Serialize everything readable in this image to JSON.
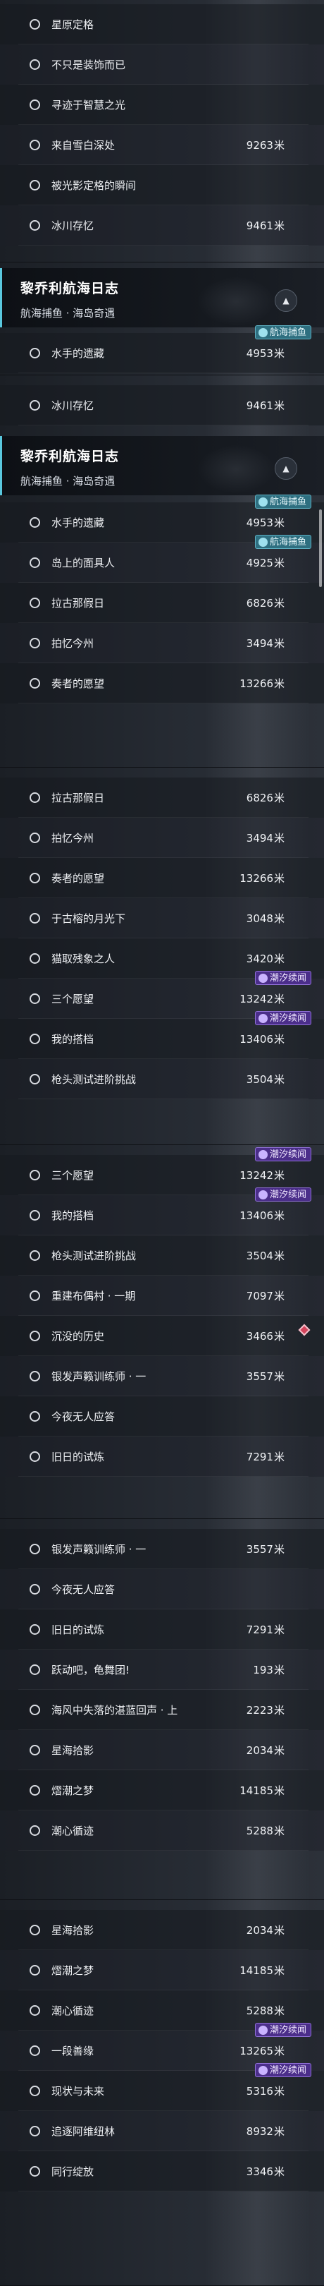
{
  "unit": "米",
  "badges": {
    "voyage": "航海捕鱼",
    "spring": "潮汐续闻"
  },
  "header": {
    "title": "黎乔利航海日志",
    "subtitle": "航海捕鱼 · 海岛奇遇",
    "toggle_icon": "chevron-up-icon"
  },
  "segments": [
    {
      "rows": [
        {
          "name": "星原定格",
          "dist": ""
        },
        {
          "name": "不只是装饰而已",
          "dist": ""
        },
        {
          "name": "寻迹于智慧之光",
          "dist": ""
        },
        {
          "name": "来自雪白深处",
          "dist": "9263"
        },
        {
          "name": "被光影定格的瞬间",
          "dist": ""
        },
        {
          "name": "冰川存忆",
          "dist": "9461"
        }
      ]
    },
    {
      "rows": [
        {
          "name": "水手的遗藏",
          "dist": "4953",
          "badge": "voyage"
        }
      ]
    },
    {
      "rows": [
        {
          "name": "冰川存忆",
          "dist": "9461"
        }
      ]
    },
    {
      "rows": [
        {
          "name": "水手的遗藏",
          "dist": "4953",
          "badge": "voyage"
        },
        {
          "name": "岛上的面具人",
          "dist": "4925",
          "badge": "voyage"
        },
        {
          "name": "拉古那假日",
          "dist": "6826"
        },
        {
          "name": "拍忆今州",
          "dist": "3494"
        },
        {
          "name": "奏者的愿望",
          "dist": "13266"
        }
      ]
    },
    {
      "rows": [
        {
          "name": "拉古那假日",
          "dist": "6826"
        },
        {
          "name": "拍忆今州",
          "dist": "3494"
        },
        {
          "name": "奏者的愿望",
          "dist": "13266"
        },
        {
          "name": "于古榕的月光下",
          "dist": "3048"
        },
        {
          "name": "猫取残象之人",
          "dist": "3420"
        },
        {
          "name": "三个愿望",
          "dist": "13242",
          "badge": "spring"
        },
        {
          "name": "我的搭档",
          "dist": "13406",
          "badge": "spring"
        },
        {
          "name": "枪头测试进阶挑战",
          "dist": "3504"
        }
      ]
    },
    {
      "rows": [
        {
          "name": "三个愿望",
          "dist": "13242",
          "badge": "spring"
        },
        {
          "name": "我的搭档",
          "dist": "13406",
          "badge": "spring"
        },
        {
          "name": "枪头测试进阶挑战",
          "dist": "3504"
        },
        {
          "name": "重建布偶村 · 一期",
          "dist": "7097"
        },
        {
          "name": "沉没的历史",
          "dist": "3466",
          "marker": true
        },
        {
          "name": "银发声籁训练师 · 一",
          "dist": "3557"
        },
        {
          "name": "今夜无人应答",
          "dist": ""
        },
        {
          "name": "旧日的试炼",
          "dist": "7291"
        }
      ]
    },
    {
      "rows": [
        {
          "name": "银发声籁训练师 · 一",
          "dist": "3557"
        },
        {
          "name": "今夜无人应答",
          "dist": ""
        },
        {
          "name": "旧日的试炼",
          "dist": "7291"
        },
        {
          "name": "跃动吧，龟舞团!",
          "dist": "193"
        },
        {
          "name": "海风中失落的湛蓝回声 · 上",
          "dist": "2223"
        },
        {
          "name": "星海拾影",
          "dist": "2034"
        },
        {
          "name": "熠潮之梦",
          "dist": "14185"
        },
        {
          "name": "潮心循迹",
          "dist": "5288"
        }
      ]
    },
    {
      "rows": [
        {
          "name": "星海拾影",
          "dist": "2034"
        },
        {
          "name": "熠潮之梦",
          "dist": "14185"
        },
        {
          "name": "潮心循迹",
          "dist": "5288"
        },
        {
          "name": "一段善缘",
          "dist": "13265",
          "badge": "spring"
        },
        {
          "name": "现状与未来",
          "dist": "5316",
          "badge": "spring"
        },
        {
          "name": "追逐阿维纽林",
          "dist": "8932"
        },
        {
          "name": "同行绽放",
          "dist": "3346"
        }
      ]
    }
  ]
}
